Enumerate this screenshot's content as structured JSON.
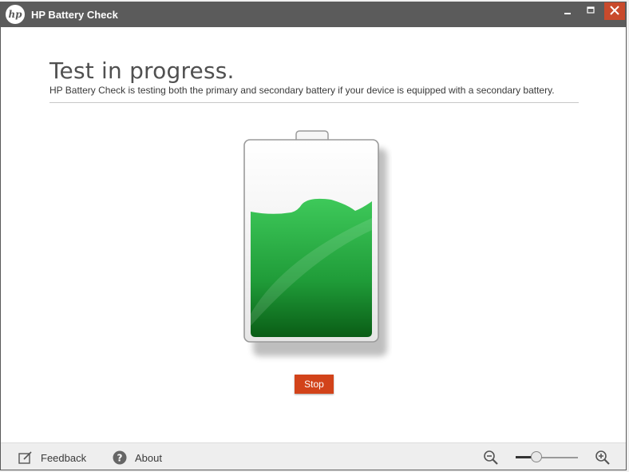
{
  "window": {
    "title": "HP Battery Check",
    "logo_text": "hp",
    "controls": [
      "minimize-icon",
      "maximize-icon",
      "close-icon"
    ],
    "close_color": "#c94a2c"
  },
  "main": {
    "heading": "Test in progress.",
    "description": "HP Battery Check is testing both the primary and secondary battery if your device is equipped with a secondary battery.",
    "battery_fill_level": 0.7,
    "battery_color": "#2db34a",
    "stop_label": "Stop",
    "stop_color": "#d2431a"
  },
  "footer": {
    "feedback_label": "Feedback",
    "about_label": "About",
    "zoom_level": 0.3
  }
}
